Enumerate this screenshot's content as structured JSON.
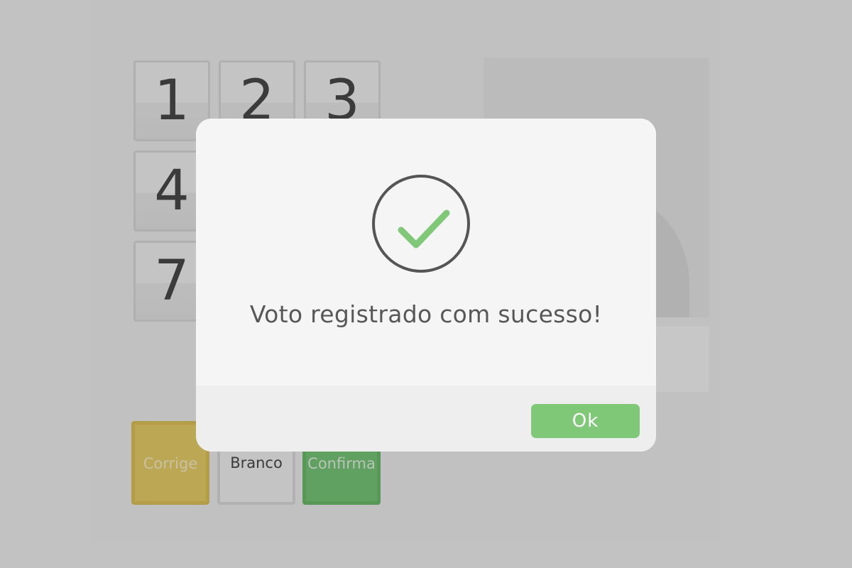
{
  "keypad": {
    "keys": [
      "1",
      "2",
      "3",
      "4",
      "7"
    ]
  },
  "actions": {
    "corrige_label": "Corrige",
    "branco_label": "Branco",
    "confirma_label": "Confirma"
  },
  "dialog": {
    "icon": "check-circle-icon",
    "message": "Voto registrado com sucesso!",
    "ok_label": "Ok"
  },
  "colors": {
    "success_green": "#7fc878",
    "corrige_yellow": "#ecd26a",
    "confirma_green": "#78c878",
    "overlay": "rgba(0,0,0,0.2)"
  }
}
